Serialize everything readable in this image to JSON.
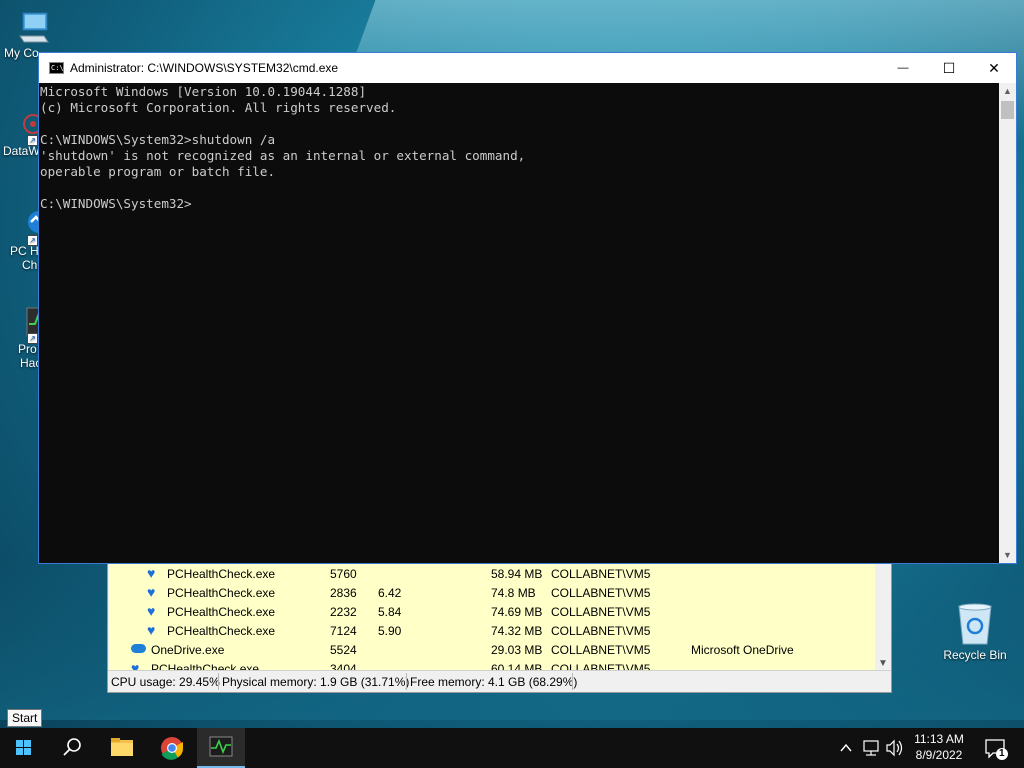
{
  "desktop": {
    "icons_left": [
      {
        "label": "My Co"
      },
      {
        "label": "DataW"
      },
      {
        "label_line1": "PC H",
        "label_line2": "Che"
      },
      {
        "label_line1": "Pro",
        "label_line2": "Hac"
      }
    ],
    "recycle_bin": {
      "label": "Recycle Bin"
    }
  },
  "cmd_window": {
    "title": "Administrator: C:\\WINDOWS\\SYSTEM32\\cmd.exe",
    "icon_text": "C:\\",
    "minimize_glyph": "—",
    "maximize_glyph": "☐",
    "close_glyph": "✕",
    "lines": [
      "Microsoft Windows [Version 10.0.19044.1288]",
      "(c) Microsoft Corporation. All rights reserved.",
      "",
      "C:\\WINDOWS\\System32>shutdown /a",
      "'shutdown' is not recognized as an internal or external command,",
      "operable program or batch file.",
      "",
      "C:\\WINDOWS\\System32>"
    ]
  },
  "process_hacker": {
    "rows": [
      {
        "name": "PCHealthCheck.exe",
        "pid": "5760",
        "cpu": "",
        "mem": "58.94 MB",
        "user": "COLLABNET\\VM5",
        "desc": "",
        "icon": "heart-icon",
        "indent": 1
      },
      {
        "name": "PCHealthCheck.exe",
        "pid": "2836",
        "cpu": "6.42",
        "mem": "74.8 MB",
        "user": "COLLABNET\\VM5",
        "desc": "",
        "icon": "heart-icon",
        "indent": 1
      },
      {
        "name": "PCHealthCheck.exe",
        "pid": "2232",
        "cpu": "5.84",
        "mem": "74.69 MB",
        "user": "COLLABNET\\VM5",
        "desc": "",
        "icon": "heart-icon",
        "indent": 1
      },
      {
        "name": "PCHealthCheck.exe",
        "pid": "7124",
        "cpu": "5.90",
        "mem": "74.32 MB",
        "user": "COLLABNET\\VM5",
        "desc": "",
        "icon": "heart-icon",
        "indent": 1
      },
      {
        "name": "OneDrive.exe",
        "pid": "5524",
        "cpu": "",
        "mem": "29.03 MB",
        "user": "COLLABNET\\VM5",
        "desc": "Microsoft OneDrive",
        "icon": "cloud-icon",
        "indent": 0
      },
      {
        "name": "PCHealthCheck.exe",
        "pid": "3404",
        "cpu": "",
        "mem": "60.14 MB",
        "user": "COLLABNET\\VM5",
        "desc": "",
        "icon": "heart-icon",
        "indent": 0
      }
    ],
    "status": {
      "cpu": "CPU usage: 29.45%",
      "physical": "Physical memory: 1.9 GB (31.71%)",
      "free": "Free memory: 4.1 GB (68.29%)"
    }
  },
  "start_tooltip": "Start",
  "taskbar": {
    "time": "11:13 AM",
    "date": "8/9/2022",
    "notification_count": "1"
  },
  "colors": {
    "cmd_bg": "#0c0c0c",
    "cmd_text": "#cccccc",
    "ph_row_bg": "#ffffc8",
    "taskbar_bg": "#101010",
    "accent": "#76b9ed"
  }
}
